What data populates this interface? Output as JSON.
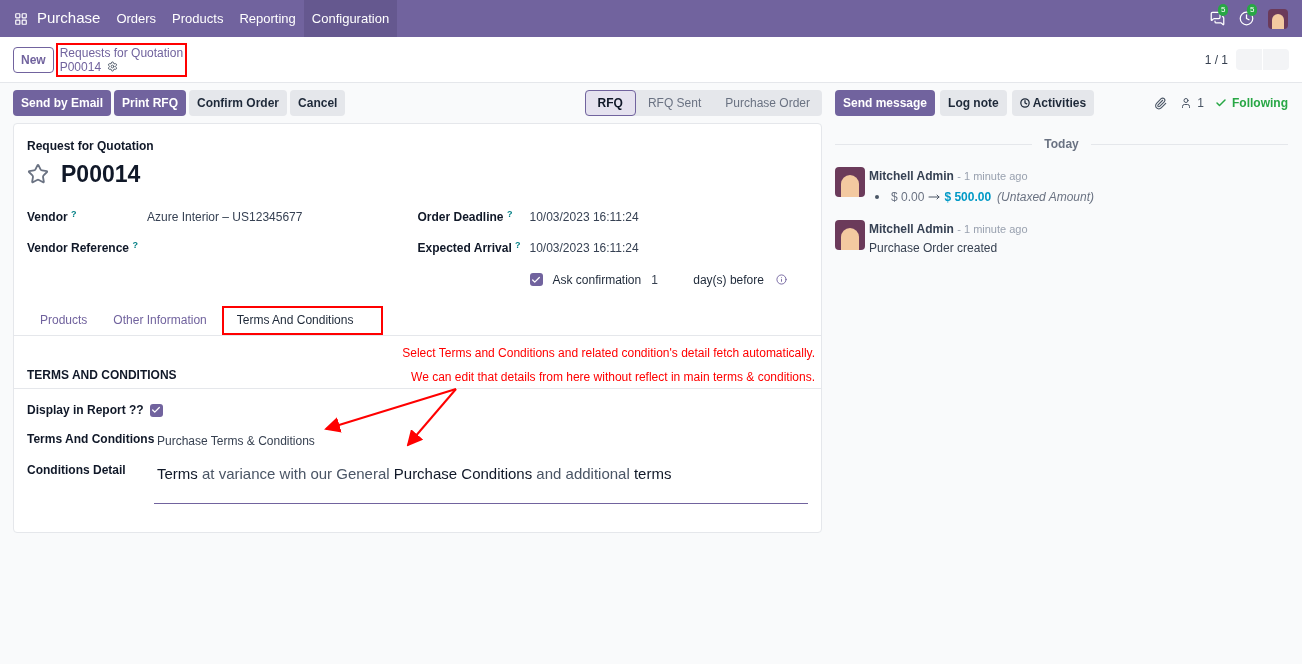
{
  "navbar": {
    "app": "Purchase",
    "menu": [
      {
        "label": "Orders",
        "selected": false
      },
      {
        "label": "Products",
        "selected": false
      },
      {
        "label": "Reporting",
        "selected": false
      },
      {
        "label": "Configuration",
        "selected": true
      }
    ],
    "messages_count": "5",
    "activities_count": "5"
  },
  "control_panel": {
    "new_button": "New",
    "breadcrumb": "Requests for Quotation",
    "record": "P00014",
    "highlighted": true,
    "pager": "1 / 1"
  },
  "actions": [
    {
      "label": "Send by Email",
      "primary": true
    },
    {
      "label": "Print RFQ",
      "primary": true
    },
    {
      "label": "Confirm Order",
      "primary": false
    },
    {
      "label": "Cancel",
      "primary": false
    }
  ],
  "statusbar": [
    {
      "label": "RFQ",
      "selected": true
    },
    {
      "label": "RFQ Sent",
      "selected": false
    },
    {
      "label": "Purchase Order",
      "selected": false
    }
  ],
  "form": {
    "subtitle": "Request for Quotation",
    "name": "P00014",
    "starred": false,
    "left_fields": [
      {
        "label": "Vendor",
        "help": "?",
        "value": "Azure Interior – US12345677"
      },
      {
        "label": "Vendor Reference",
        "help": "?"
      }
    ],
    "right_fields": [
      {
        "label": "Order Deadline",
        "help": "?",
        "value": "10/03/2023 16:11:24"
      },
      {
        "label": "Expected Arrival",
        "help": "?",
        "value": "10/03/2023 16:11:24"
      }
    ],
    "ask_confirmation": {
      "checked": true,
      "label": "Ask confirmation",
      "days": "1",
      "suffix": "day(s) before"
    },
    "tabs": [
      {
        "label": "Products",
        "selected": false,
        "highlighted": false
      },
      {
        "label": "Other Information",
        "selected": false,
        "highlighted": false
      },
      {
        "label": "Terms And Conditions",
        "selected": true,
        "highlighted": true
      }
    ],
    "annotations": [
      "Select Terms and Conditions and related condition's detail fetch automatically.",
      "We can edit that details from here without reflect in main terms & conditions."
    ],
    "section_title": "TERMS AND CONDITIONS",
    "display_in_report": {
      "label": "Display in Report ??",
      "checked": true
    },
    "terms": {
      "label": "Terms And Conditions",
      "value": "Purchase Terms & Conditions"
    },
    "conditions_detail": {
      "label": "Conditions Detail",
      "value": "**Terms** at variance with our General **Purchase Conditions** and additional **terms**"
    }
  },
  "chatter": {
    "buttons": [
      {
        "label": "Send message",
        "primary": true
      },
      {
        "label": "Log note",
        "primary": false
      },
      {
        "label": "Activities",
        "primary": false
      }
    ],
    "followers": "1",
    "following": "Following",
    "day": "Today",
    "messages": [
      {
        "kind": "tracking",
        "author": "Mitchell Admin",
        "time": "- 1 minute ago",
        "old": "$ 0.00",
        "new": "$ 500.00",
        "field": "(Untaxed Amount)"
      },
      {
        "kind": "text",
        "author": "Mitchell Admin",
        "time": "- 1 minute ago",
        "body": "Purchase Order created"
      }
    ]
  }
}
